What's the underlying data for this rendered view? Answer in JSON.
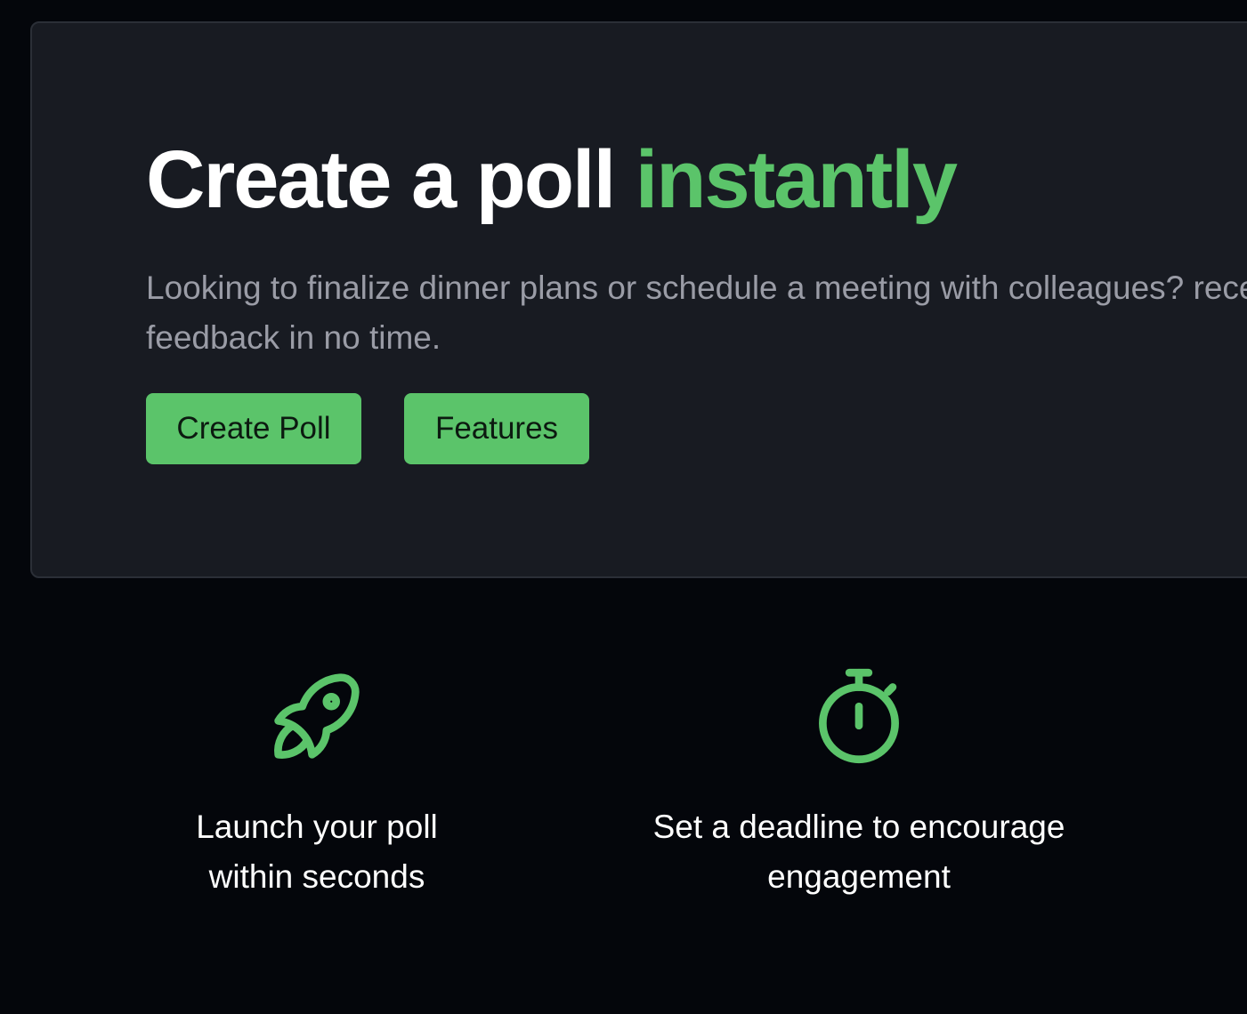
{
  "hero": {
    "title_main": "Create a poll ",
    "title_accent": "instantly",
    "description": "Looking to finalize dinner plans or schedule a meeting with colleagues? receive feedback in no time.",
    "buttons": {
      "create_label": "Create Poll",
      "features_label": "Features"
    }
  },
  "features": [
    {
      "icon": "rocket-icon",
      "text": "Launch your poll within seconds"
    },
    {
      "icon": "stopwatch-icon",
      "text": "Set a deadline to encourage engagement"
    }
  ],
  "colors": {
    "accent": "#5bc46a",
    "background": "#04060b",
    "card": "#181b22",
    "muted_text": "#9a9ca6"
  }
}
